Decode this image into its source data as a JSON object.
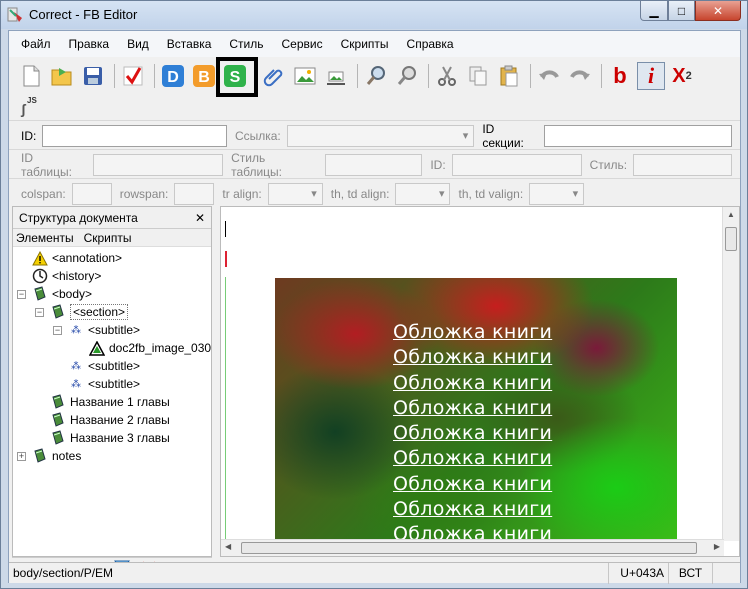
{
  "window": {
    "title": "Correct - FB Editor"
  },
  "menu": [
    "Файл",
    "Правка",
    "Вид",
    "Вставка",
    "Стиль",
    "Сервис",
    "Скрипты",
    "Справка"
  ],
  "toolbar": {
    "icons": [
      "new-document-icon",
      "open-folder-icon",
      "save-icon",
      "check-icon",
      "d-icon",
      "b-icon",
      "s-icon",
      "paperclip-icon",
      "image-icon",
      "image-inline-icon",
      "find-icon",
      "replace-icon",
      "cut-icon",
      "copy-icon",
      "paste-icon",
      "undo-icon",
      "redo-icon"
    ],
    "bold": "b",
    "italic": "i",
    "superscript": "X",
    "superscript_exp": "2",
    "js_label": "JS"
  },
  "form": {
    "row1": {
      "id_label": "ID:",
      "link_label": "Ссылка:",
      "section_id_label": "ID секции:"
    },
    "row2": {
      "table_id_label": "ID таблицы:",
      "table_style_label": "Стиль таблицы:",
      "id_label": "ID:",
      "style_label": "Стиль:"
    },
    "row3": {
      "colspan_label": "colspan:",
      "rowspan_label": "rowspan:",
      "tr_align_label": "tr align:",
      "th_td_align_label": "th, td align:",
      "th_td_valign_label": "th, td valign:"
    }
  },
  "panel": {
    "title": "Структура документа",
    "close": "✕",
    "tab_elements": "Элементы",
    "tab_scripts": "Скрипты",
    "tree": [
      {
        "label": "<annotation>"
      },
      {
        "label": "<history>"
      },
      {
        "label": "<body>"
      },
      {
        "label": "<section>"
      },
      {
        "label": "<subtitle>"
      },
      {
        "label": "doc2fb_image_030"
      },
      {
        "label": "<subtitle>"
      },
      {
        "label": "<subtitle>"
      },
      {
        "label": "Название 1 главы"
      },
      {
        "label": "Название 2 главы"
      },
      {
        "label": "Название 3 главы"
      },
      {
        "label": "notes"
      }
    ]
  },
  "editor": {
    "cover_lines": [
      "Обложка книги",
      "Обложка книги",
      "Обложка книги",
      "Обложка книги",
      "Обложка книги",
      "Обложка книги",
      "Обложка книги",
      "Обложка книги",
      "Обложка книги"
    ]
  },
  "status": {
    "path": "body/section/P/EM",
    "char": "U+043A",
    "mode": "ВСТ"
  }
}
